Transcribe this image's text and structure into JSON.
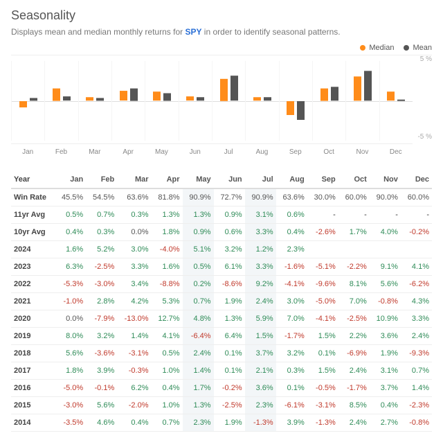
{
  "header": {
    "title": "Seasonality",
    "subtitle_prefix": "Displays mean and median monthly returns for ",
    "ticker": "SPY",
    "subtitle_suffix": " in order to identify seasonal patterns."
  },
  "legend": {
    "median": "Median",
    "mean": "Mean"
  },
  "axis": {
    "y_top": "5 %",
    "y_bot": "-5 %"
  },
  "chart_data": {
    "type": "bar",
    "title": "Seasonality — Median & Mean monthly returns (%) for SPY",
    "xlabel": "",
    "ylabel": "%",
    "ylim": [
      -5,
      5
    ],
    "categories": [
      "Jan",
      "Feb",
      "Mar",
      "Apr",
      "May",
      "Jun",
      "Jul",
      "Aug",
      "Sep",
      "Oct",
      "Nov",
      "Dec"
    ],
    "series": [
      {
        "name": "Median",
        "values": [
          -0.8,
          1.6,
          0.5,
          1.3,
          1.2,
          0.6,
          2.8,
          0.5,
          -1.8,
          1.6,
          3.1,
          1.2
        ]
      },
      {
        "name": "Mean",
        "values": [
          0.4,
          0.6,
          0.4,
          1.6,
          1.0,
          0.5,
          3.2,
          0.5,
          -2.4,
          1.8,
          3.8,
          0.2
        ]
      }
    ]
  },
  "highlight_cols": [
    5,
    7
  ],
  "table": {
    "columns": [
      "Year",
      "Jan",
      "Feb",
      "Mar",
      "Apr",
      "May",
      "Jun",
      "Jul",
      "Aug",
      "Sep",
      "Oct",
      "Nov",
      "Dec"
    ],
    "rows": [
      {
        "label": "Win Rate",
        "type": "neutral",
        "cells": [
          "45.5%",
          "54.5%",
          "63.6%",
          "81.8%",
          "90.9%",
          "72.7%",
          "90.9%",
          "63.6%",
          "30.0%",
          "60.0%",
          "90.0%",
          "60.0%"
        ]
      },
      {
        "label": "11yr Avg",
        "type": "signed",
        "cells": [
          "0.5%",
          "0.7%",
          "0.3%",
          "1.3%",
          "1.3%",
          "0.9%",
          "3.1%",
          "0.6%",
          "-",
          "-",
          "-",
          "-"
        ]
      },
      {
        "label": "10yr Avg",
        "type": "signed",
        "cells": [
          "0.4%",
          "0.3%",
          "0.0%",
          "1.8%",
          "0.9%",
          "0.6%",
          "3.3%",
          "0.4%",
          "-2.6%",
          "1.7%",
          "4.0%",
          "-0.2%"
        ]
      },
      {
        "label": "2024",
        "type": "signed",
        "cells": [
          "1.6%",
          "5.2%",
          "3.0%",
          "-4.0%",
          "5.1%",
          "3.2%",
          "1.2%",
          "2.3%",
          "",
          "",
          "",
          ""
        ]
      },
      {
        "label": "2023",
        "type": "signed",
        "cells": [
          "6.3%",
          "-2.5%",
          "3.3%",
          "1.6%",
          "0.5%",
          "6.1%",
          "3.3%",
          "-1.6%",
          "-5.1%",
          "-2.2%",
          "9.1%",
          "4.1%"
        ]
      },
      {
        "label": "2022",
        "type": "signed",
        "cells": [
          "-5.3%",
          "-3.0%",
          "3.4%",
          "-8.8%",
          "0.2%",
          "-8.6%",
          "9.2%",
          "-4.1%",
          "-9.6%",
          "8.1%",
          "5.6%",
          "-6.2%"
        ]
      },
      {
        "label": "2021",
        "type": "signed",
        "cells": [
          "-1.0%",
          "2.8%",
          "4.2%",
          "5.3%",
          "0.7%",
          "1.9%",
          "2.4%",
          "3.0%",
          "-5.0%",
          "7.0%",
          "-0.8%",
          "4.3%"
        ]
      },
      {
        "label": "2020",
        "type": "signed",
        "cells": [
          "0.0%",
          "-7.9%",
          "-13.0%",
          "12.7%",
          "4.8%",
          "1.3%",
          "5.9%",
          "7.0%",
          "-4.1%",
          "-2.5%",
          "10.9%",
          "3.3%"
        ]
      },
      {
        "label": "2019",
        "type": "signed",
        "cells": [
          "8.0%",
          "3.2%",
          "1.4%",
          "4.1%",
          "-6.4%",
          "6.4%",
          "1.5%",
          "-1.7%",
          "1.5%",
          "2.2%",
          "3.6%",
          "2.4%"
        ]
      },
      {
        "label": "2018",
        "type": "signed",
        "cells": [
          "5.6%",
          "-3.6%",
          "-3.1%",
          "0.5%",
          "2.4%",
          "0.1%",
          "3.7%",
          "3.2%",
          "0.1%",
          "-6.9%",
          "1.9%",
          "-9.3%"
        ]
      },
      {
        "label": "2017",
        "type": "signed",
        "cells": [
          "1.8%",
          "3.9%",
          "-0.3%",
          "1.0%",
          "1.4%",
          "0.1%",
          "2.1%",
          "0.3%",
          "1.5%",
          "2.4%",
          "3.1%",
          "0.7%"
        ]
      },
      {
        "label": "2016",
        "type": "signed",
        "cells": [
          "-5.0%",
          "-0.1%",
          "6.2%",
          "0.4%",
          "1.7%",
          "-0.2%",
          "3.6%",
          "0.1%",
          "-0.5%",
          "-1.7%",
          "3.7%",
          "1.4%"
        ]
      },
      {
        "label": "2015",
        "type": "signed",
        "cells": [
          "-3.0%",
          "5.6%",
          "-2.0%",
          "1.0%",
          "1.3%",
          "-2.5%",
          "2.3%",
          "-6.1%",
          "-3.1%",
          "8.5%",
          "0.4%",
          "-2.3%"
        ]
      },
      {
        "label": "2014",
        "type": "signed",
        "cells": [
          "-3.5%",
          "4.6%",
          "0.4%",
          "0.7%",
          "2.3%",
          "1.9%",
          "-1.3%",
          "3.9%",
          "-1.3%",
          "2.4%",
          "2.7%",
          "-0.8%"
        ]
      }
    ]
  }
}
